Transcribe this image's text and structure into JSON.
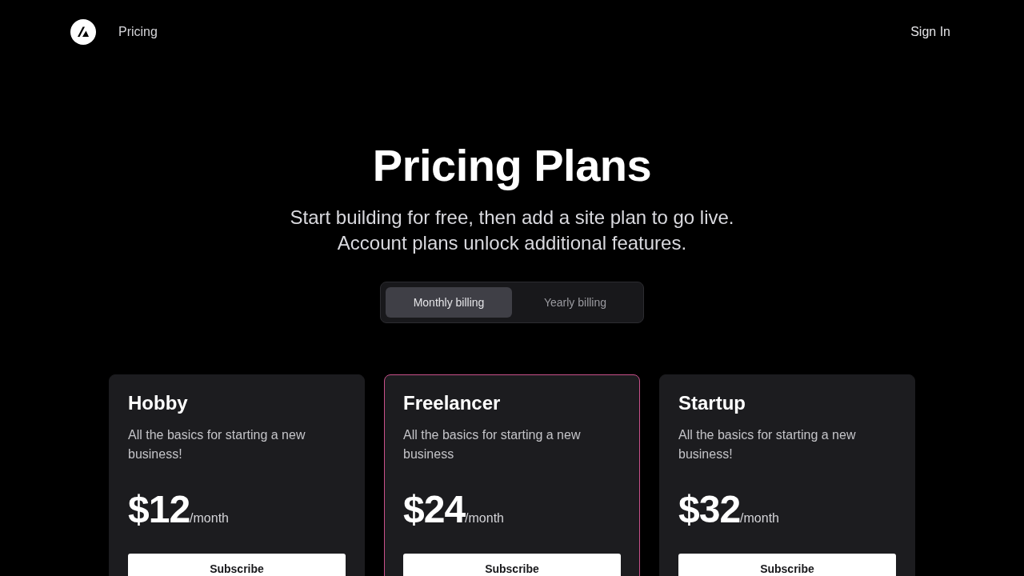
{
  "header": {
    "nav_links": [
      {
        "label": "Pricing"
      }
    ],
    "sign_in": "Sign In"
  },
  "hero": {
    "title": "Pricing Plans",
    "subtitle": [
      "Start building for free, then add a site plan to go live.",
      "Account plans unlock additional features."
    ]
  },
  "billing_toggle": [
    {
      "label": "Monthly billing",
      "selected": true
    },
    {
      "label": "Yearly billing",
      "selected": false
    }
  ],
  "plans": [
    {
      "name": "Hobby",
      "description": "All the basics for starting a new business!",
      "price": "$12",
      "period": "/month",
      "button": "Subscribe",
      "selected": false
    },
    {
      "name": "Freelancer",
      "description": "All the basics for starting a new business",
      "price": "$24",
      "period": "/month",
      "button": "Subscribe",
      "selected": true
    },
    {
      "name": "Startup",
      "description": "All the basics for starting a new business!",
      "price": "$32",
      "period": "/month",
      "button": "Subscribe",
      "selected": false
    }
  ]
}
